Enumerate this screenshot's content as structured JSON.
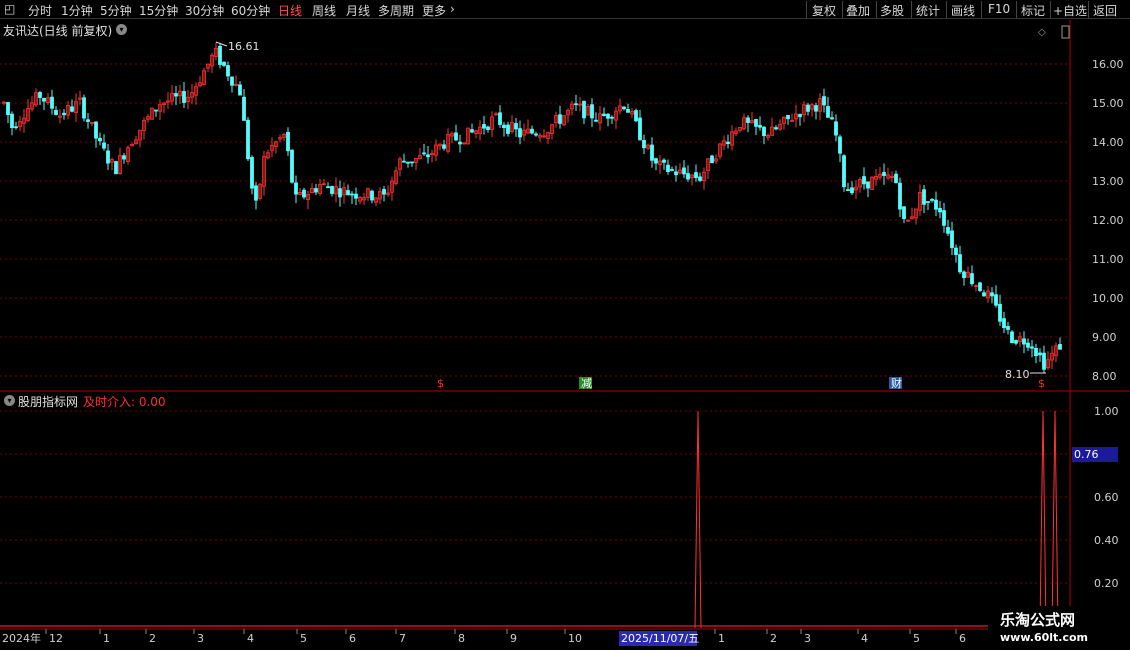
{
  "toolbar": {
    "periods": [
      "分时",
      "1分钟",
      "5分钟",
      "15分钟",
      "30分钟",
      "60分钟",
      "日线",
      "周线",
      "月线",
      "多周期",
      "更多"
    ],
    "active": "日线",
    "actions": [
      "复权",
      "叠加",
      "多股",
      "统计",
      "画线",
      "F10",
      "标记",
      "+自选",
      "返回"
    ]
  },
  "main_chart": {
    "title": "友讯达(日线 前复权)",
    "high_label": "16.61",
    "low_label": "8.10",
    "y_ticks": [
      "16.00",
      "15.00",
      "14.00",
      "13.00",
      "12.00",
      "11.00",
      "10.00",
      "9.00",
      "8.00"
    ],
    "markers": [
      "$",
      "减",
      "财",
      "$"
    ]
  },
  "sub_chart": {
    "title": "股朋指标网",
    "indicator_label": "及时介入: 0.00",
    "y_ticks": [
      "1.00",
      "0.60",
      "0.40",
      "0.20"
    ],
    "cursor_value": "0.76"
  },
  "axis": {
    "year_label": "2024年",
    "months": [
      "12",
      "1",
      "2",
      "3",
      "4",
      "5",
      "6",
      "7",
      "8",
      "9",
      "10",
      "1",
      "1",
      "2",
      "3",
      "4",
      "5",
      "6"
    ],
    "cursor_date": "2025/11/07/五"
  },
  "watermark": {
    "line1": "乐淘公式网",
    "line2": "www.60lt.com"
  },
  "colors": {
    "up": "#ff3232",
    "down": "#54fcfc",
    "grid": "#7a0000",
    "frame": "#b00000"
  }
}
